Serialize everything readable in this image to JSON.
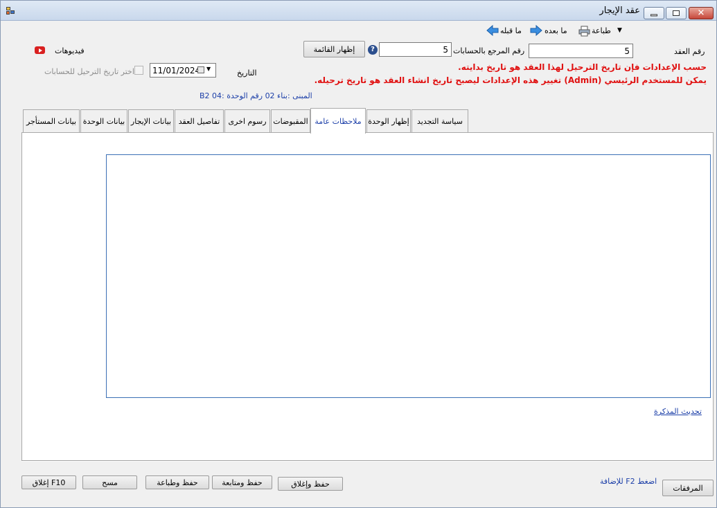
{
  "window": {
    "title": "عقد الإيجار",
    "close_glyph": "✕"
  },
  "toolbar": {
    "print_label": "طباعة",
    "next_label": "ما بعده",
    "prev_label": "ما قبله",
    "dropdown_glyph": "▼"
  },
  "form": {
    "contract_no_label": "رقم العقد",
    "contract_no_value": "5",
    "ref_no_label": "رقم المرجع بالحسابات",
    "ref_no_value": "5",
    "show_list_button": "إظهار القائمة",
    "help_glyph": "?",
    "videos_label": "فيديوهات",
    "date_label": "التاريخ",
    "date_value": "11/01/2024",
    "posting_checkbox_label": "اختر تاريخ الترحيل للحسابات",
    "warning_line1": "حسب الإعدادات فإن تاريخ الترحيل لهذا العقد هو تاريخ بدايته.",
    "warning_line2": "يمكن للمستخدم الرئيسي (Admin) تغيير هذه الإعدادات ليصبح تاريخ انشاء العقد هو تاريخ ترحيله.",
    "building_info": "المبنى :بناء 02 رقم الوحدة :04 B2"
  },
  "tabs": [
    {
      "label": "بيانات المستأجر",
      "active": false
    },
    {
      "label": "بيانات الوحدة",
      "active": false
    },
    {
      "label": "بيانات الإيجار",
      "active": false
    },
    {
      "label": "تفاصيل العقد",
      "active": false
    },
    {
      "label": "رسوم اخرى",
      "active": false
    },
    {
      "label": "المقبوضات",
      "active": false
    },
    {
      "label": "ملاحظات عامة",
      "active": true
    },
    {
      "label": "إظهار الوحدة",
      "active": false
    },
    {
      "label": "سياسة التجديد",
      "active": false
    }
  ],
  "notes": {
    "value": "",
    "update_memo_link": "تحديث المذكرة"
  },
  "footer": {
    "attachments_button": "المرفقات",
    "f2_hint": "اضغط F2 للإضافة",
    "save_close": "حفظ وإغلاق",
    "save_continue": "حفظ ومتابعة",
    "save_print": "حفظ وطباعة",
    "clear": "مسح",
    "close_f10": "إغلاق F10"
  },
  "colors": {
    "warning": "#e01010",
    "link": "#1c3fa8",
    "accent_border": "#3a6fb5"
  }
}
